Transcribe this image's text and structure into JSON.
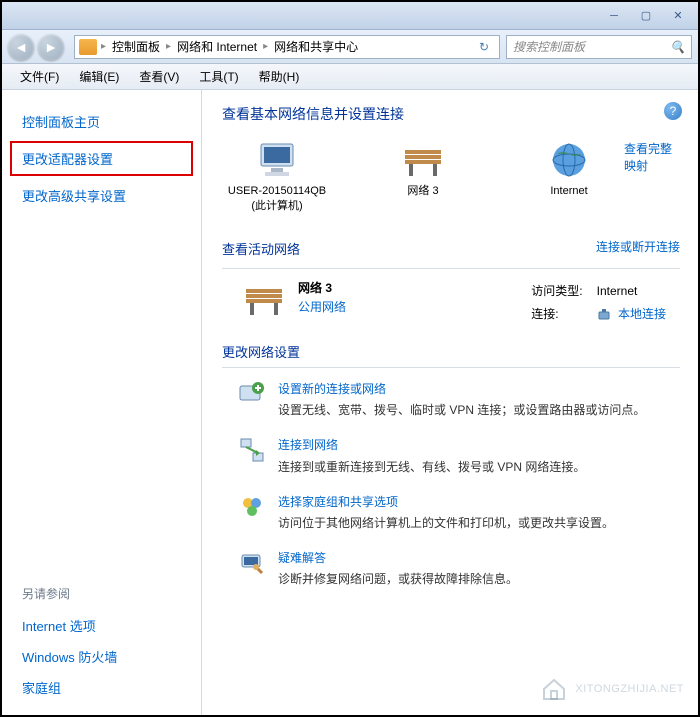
{
  "breadcrumb": {
    "item1": "控制面板",
    "item2": "网络和 Internet",
    "item3": "网络和共享中心"
  },
  "search": {
    "placeholder": "搜索控制面板"
  },
  "menu": {
    "file": "文件(F)",
    "edit": "编辑(E)",
    "view": "查看(V)",
    "tools": "工具(T)",
    "help": "帮助(H)"
  },
  "sidebar": {
    "home": "控制面板主页",
    "adapter": "更改适配器设置",
    "advanced": "更改高级共享设置",
    "also_title": "另请参阅",
    "also": {
      "internet": "Internet 选项",
      "firewall": "Windows 防火墙",
      "homegroup": "家庭组"
    }
  },
  "heading": "查看基本网络信息并设置连接",
  "map": {
    "computer": "USER-20150114QB",
    "computer_sub": "(此计算机)",
    "network": "网络  3",
    "internet": "Internet",
    "view_full": "查看完整映射"
  },
  "active": {
    "title": "查看活动网络",
    "link": "连接或断开连接",
    "net_name": "网络  3",
    "net_type": "公用网络",
    "access_label": "访问类型:",
    "access_value": "Internet",
    "conn_label": "连接:",
    "conn_value": "本地连接"
  },
  "change": {
    "title": "更改网络设置",
    "s1_title": "设置新的连接或网络",
    "s1_desc": "设置无线、宽带、拨号、临时或 VPN 连接；或设置路由器或访问点。",
    "s2_title": "连接到网络",
    "s2_desc": "连接到或重新连接到无线、有线、拨号或 VPN 网络连接。",
    "s3_title": "选择家庭组和共享选项",
    "s3_desc": "访问位于其他网络计算机上的文件和打印机，或更改共享设置。",
    "s4_title": "疑难解答",
    "s4_desc": "诊断并修复网络问题，或获得故障排除信息。"
  },
  "watermark": "XITONGZHIJIA.NET"
}
